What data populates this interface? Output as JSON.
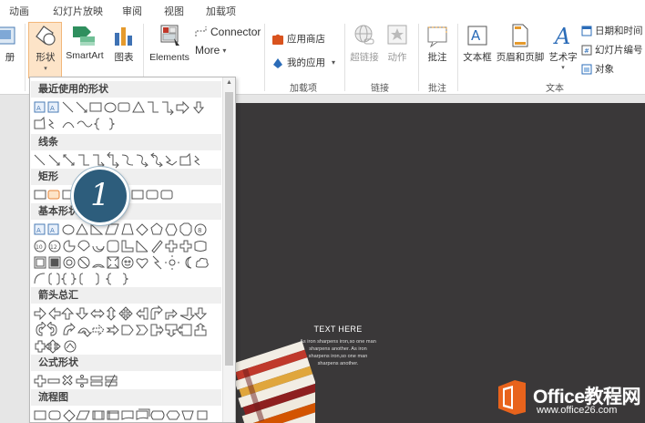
{
  "tabs": [
    "动画",
    "幻灯片放映",
    "审阅",
    "视图",
    "加载项"
  ],
  "ribbon": {
    "album_partial": "册",
    "shapes_label": "形状",
    "smartart_label": "SmartArt",
    "chart_label": "图表",
    "elements_label": "Elements",
    "connector_label": "Connector",
    "more_label": "More",
    "store_label": "应用商店",
    "myapps_label": "我的应用",
    "addins_group": "加载项",
    "hyperlink_label": "超链接",
    "action_label": "动作",
    "links_group": "链接",
    "comment_label": "批注",
    "comments_group": "批注",
    "textbox_label": "文本框",
    "headerfooter_label": "页眉和页脚",
    "wordart_label": "艺术字",
    "datetime_label": "日期和时间",
    "slidenum_label": "幻灯片编号",
    "object_label": "对象",
    "text_group": "文本"
  },
  "dropdown": {
    "categories": [
      "最近使用的形状",
      "线条",
      "矩形",
      "基本形状",
      "箭头总汇",
      "公式形状",
      "流程图"
    ]
  },
  "bubble_number": "1",
  "slide": {
    "heading": "TEXT HERE",
    "body_lines": [
      "As iron sharpens iron,so one man",
      "sharpens another. As iron",
      "sharpens iron,so one man",
      "sharpens another."
    ]
  },
  "watermark": {
    "brand": "Office教程网",
    "url": "www.office26.com"
  },
  "colors": {
    "accent": "#f2b77a",
    "bubble": "#2d5d7c",
    "slide_bg": "#3a3839",
    "logo": "#e8631c"
  }
}
